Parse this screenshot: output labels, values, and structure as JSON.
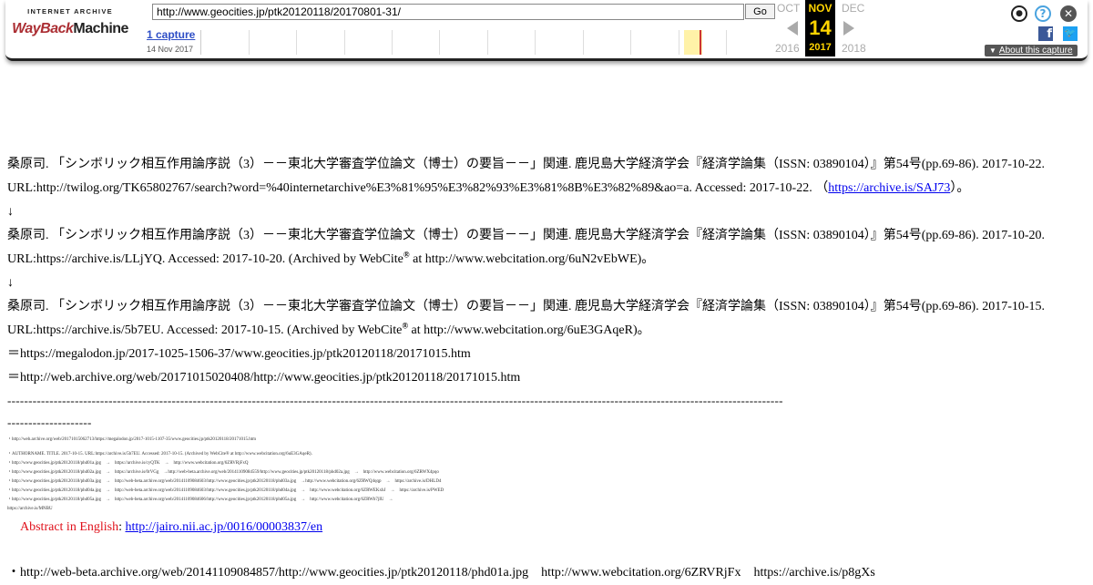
{
  "toolbar": {
    "logo_top": "INTERNET ARCHIVE",
    "logo_wayback": "WayBack",
    "logo_machine": "Machine",
    "url": "http://www.geocities.jp/ptk20120118/20170801-31/",
    "go_label": "Go",
    "captures_label": "1 capture",
    "captures_date": "14 Nov 2017",
    "prev_month": "OCT",
    "current_month": "NOV",
    "next_month": "DEC",
    "prev_year": "2016",
    "current_day": "14",
    "current_year": "2017",
    "next_year": "2018",
    "about_label": "About this capture",
    "icons": [
      "user-icon",
      "help-icon",
      "close-icon",
      "facebook-icon",
      "twitter-icon"
    ],
    "fb_glyph": "f",
    "tw_glyph": "🐦",
    "help_glyph": "?",
    "close_glyph": "✕",
    "user_glyph": "●"
  },
  "content": {
    "entry1_cite": "桑原司. 「シンボリック相互作用論序説（3）－－東北大学審査学位論文（博士）の要旨－－」関連. 鹿児島大学経済学会『経済学論集（ISSN: 03890104）』第54号(pp.69-86). 2017-10-22.",
    "entry1_url": "URL:http://twilog.org/TK65802767/search?word=%40internetarchive%E3%81%95%E3%82%93%E3%81%8B%E3%82%89&ao=a. Accessed: 2017-10-22. （",
    "entry1_link": "https://archive.is/SAJ73",
    "entry1_tail": "）。",
    "arrow1": "↓",
    "entry2_cite": "桑原司. 「シンボリック相互作用論序説（3）－－東北大学審査学位論文（博士）の要旨－－」関連. 鹿児島大学経済学会『経済学論集（ISSN: 03890104）』第54号(pp.69-86). 2017-10-20.",
    "entry2_url_a": "URL:https://archive.is/LLjYQ. Accessed: 2017-10-20. (Archived by WebCite",
    "entry2_url_b": " at http://www.webcitation.org/6uN2vEbWE)。",
    "arrow2": "↓",
    "entry3_cite": "桑原司. 「シンボリック相互作用論序説（3）－－東北大学審査学位論文（博士）の要旨－－」関連. 鹿児島大学経済学会『経済学論集（ISSN: 03890104）』第54号(pp.69-86). 2017-10-15.",
    "entry3_url_a": "URL:https://archive.is/5b7EU. Accessed: 2017-10-15. (Archived by WebCite",
    "entry3_url_b": " at http://www.webcitation.org/6uE3GAqeR)。",
    "reg": "®",
    "eq1": "＝https://megalodon.jp/2017-1025-1506-37/www.geocities.jp/ptk20120118/20171015.htm",
    "eq2": "＝http://web.archive.org/web/20171015020408/http://www.geocities.jp/ptk20120118/20171015.htm",
    "divider1": "----------------------------------------------------------------------------------------------------------------------------------------------------------------------------------------",
    "divider2": "--------------------",
    "tiny1": "・http://web.archive.org/web/20171015062713/https://megalodon.jp/2017-1015-1107-35/www.geocities.jp/ptk20120118/20171015.htm",
    "tiny2": "・AUTHORNAME. TITLE. 2017-10-15. URL:https://archive.is/5b7EU. Accessed: 2017-10-15. (Archived by WebCite® at http://www.webcitation.org/6uE3GAqeR).",
    "tiny3": "・http://www.geocities.jp/ptk20120118/phd01a.jpg　→　https://archive.is/cyQTK　→　http://www.webcitation.org/6ZRVRjFxQ",
    "tiny4": "・http://www.geocities.jp/ptk20120118/phd02a.jpg　→　https://archive.is/0rVGg　→http://web-beta.archive.org/web/20141109084559/http://www.geocities.jp/ptk20120118/phd02a.jpg　→　http://www.webcitation.org/6ZRWX4pqo",
    "tiny5": "・http://www.geocities.jp/ptk20120118/phd03a.jpg　→　http://web-beta.archive.org/web/20141109084603/http://www.geocities.jp/ptk20120118/phd03a.jpg　→http://www.webcitation.org/6ZRWQ4qqp　→　https://archive.is/DHLD4",
    "tiny6": "・http://www.geocities.jp/ptk20120118/phd04a.jpg　→　http://web-beta.archive.org/web/20141109084603/http://www.geocities.jp/ptk20120118/phd04a.jpg　→　http://www.webcitation.org/6ZRWEKxhJ　→　https://archive.is/PWED",
    "tiny7": "・http://www.geocities.jp/ptk20120118/phd05a.jpg　→　http://web-beta.archive.org/web/20141109084606/http://www.geocities.jp/ptk20120118/phd05a.jpg　→　http://www.webcitation.org/6ZRWb7jIU　→",
    "tiny8": "https://archive.is/MNBU",
    "abstract_label": "Abstract in English",
    "abstract_colon": ": ",
    "abstract_link": "http://jairo.nii.ac.jp/0016/00003837/en",
    "last_line_a": "・http://web-beta.archive.org/web/20141109084857/http://www.geocities.jp/ptk20120118/phd01a.jpg　http://www.webcitation.org/6ZRVRjFx　https://archive.is/p8gXs"
  },
  "colors": {
    "wayback_red": "#ab2e33",
    "link_blue": "#0000ee",
    "abstract_red": "#e0101a",
    "current_month_bg": "#000000",
    "current_month_text": "#ffd400"
  }
}
